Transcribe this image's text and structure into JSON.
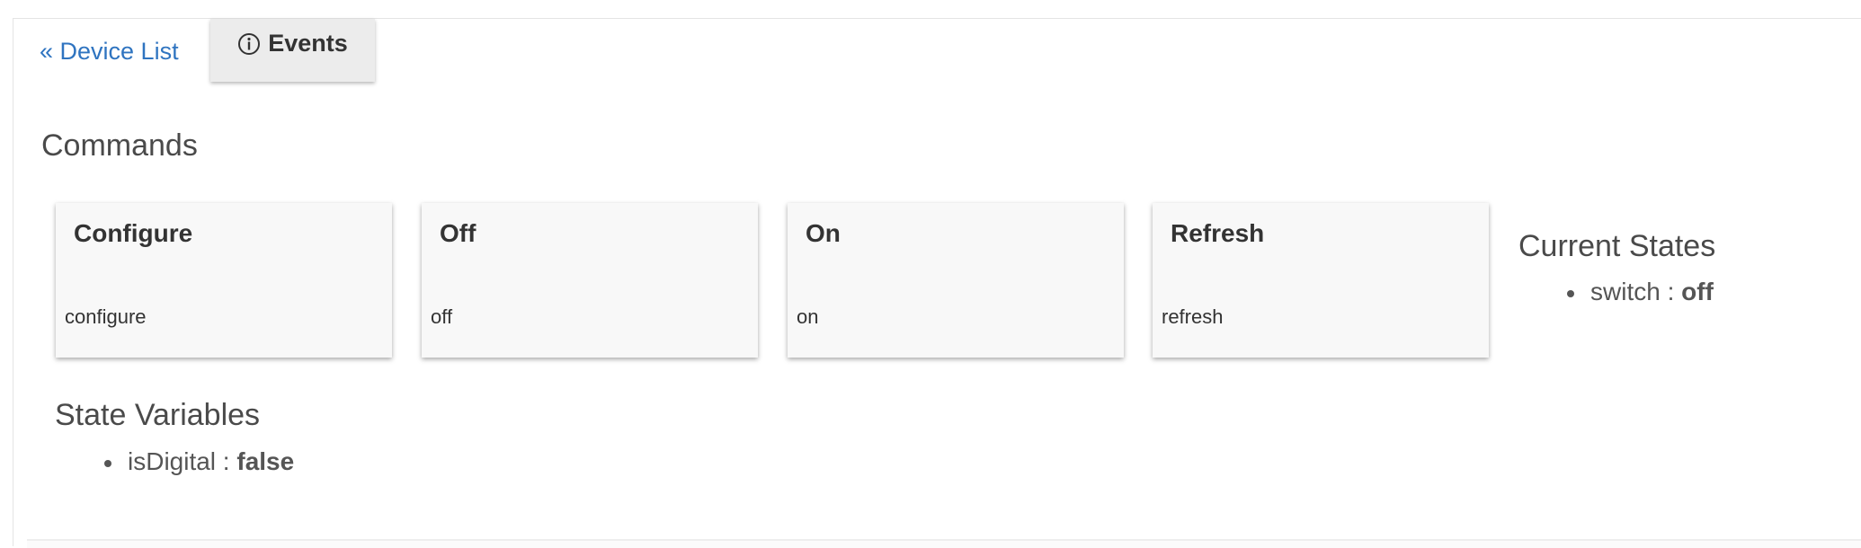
{
  "nav": {
    "back_label": "« Device List",
    "events_label": "Events"
  },
  "commands": {
    "title": "Commands",
    "items": [
      {
        "title": "Configure",
        "command": "configure"
      },
      {
        "title": "Off",
        "command": "off"
      },
      {
        "title": "On",
        "command": "on"
      },
      {
        "title": "Refresh",
        "command": "refresh"
      }
    ]
  },
  "current_states": {
    "title": "Current States",
    "items": [
      {
        "name": "switch",
        "separator": " : ",
        "value": "off"
      }
    ]
  },
  "state_variables": {
    "title": "State Variables",
    "items": [
      {
        "name": "isDigital",
        "separator": " : ",
        "value": "false"
      }
    ]
  },
  "colors": {
    "link": "#2f74c0",
    "button_bg": "#ececec",
    "card_bg": "#f8f8f8"
  },
  "icons": {
    "events": "info-circle-icon"
  }
}
